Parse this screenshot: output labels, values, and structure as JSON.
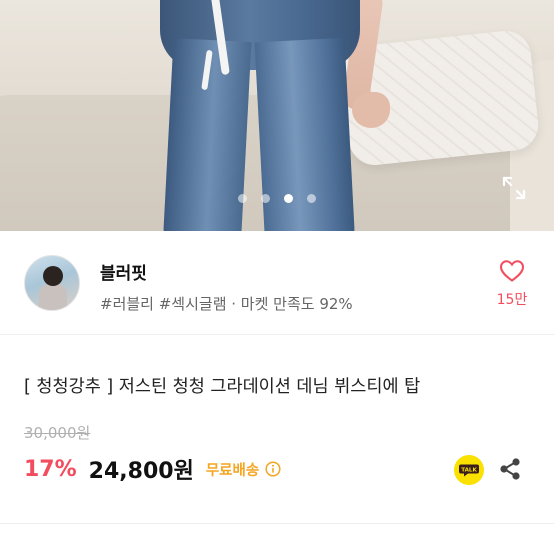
{
  "gallery": {
    "dot_count": 4,
    "active_index": 2,
    "expand_icon": "expand-icon"
  },
  "seller": {
    "name": "블러핏",
    "tags": "#러블리 #섹시글램 · 마켓 만족도 92%",
    "likes": "15만",
    "heart_icon": "heart-icon"
  },
  "product": {
    "title": "[ 청청강추 ] 저스틴 청청 그라데이션 데님 뷔스티에 탑",
    "original_price": "30,000원",
    "discount": "17%",
    "price": "24,800원",
    "shipping": "무료배송"
  },
  "actions": {
    "kakao_label": "TALK",
    "share_icon": "share-icon"
  },
  "colors": {
    "accent": "#f24d5f",
    "shipping": "#f5a623",
    "kakao": "#fae100"
  }
}
